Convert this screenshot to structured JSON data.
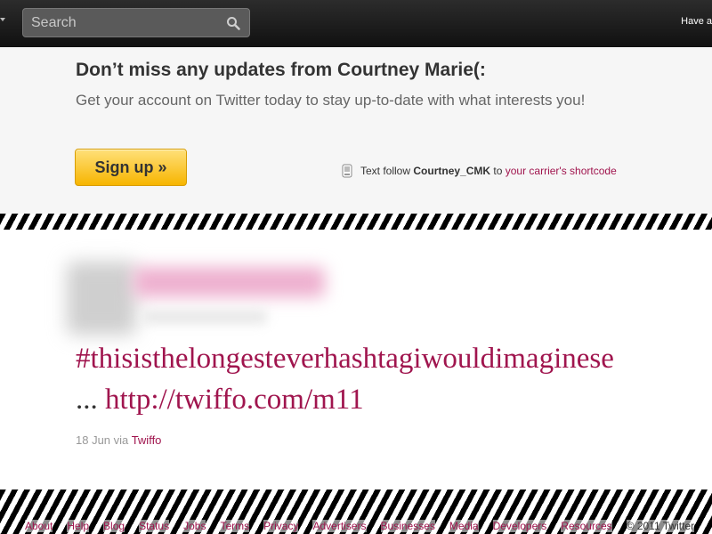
{
  "topbar": {
    "search_placeholder": "Search",
    "right_text": "Have a"
  },
  "banner": {
    "headline": "Don’t miss any updates from Courtney Marie(:",
    "subtext": "Get your account on Twitter today to stay up-to-date with what interests you!",
    "signup_label": "Sign up »",
    "text_follow_prefix": "Text follow",
    "text_follow_handle": "Courtney_CMK",
    "text_follow_to": "to",
    "text_follow_link": "your carrier's shortcode"
  },
  "tweet": {
    "hashtag": "#thisisthelongesteverhashtagiwouldimaginese",
    "ellipsis": "...",
    "url": "http://twiffo.com/m11",
    "date": "18 Jun",
    "via": "via",
    "source": "Twiffo"
  },
  "footer": {
    "links": [
      "About",
      "Help",
      "Blog",
      "Status",
      "Jobs",
      "Terms",
      "Privacy",
      "Advertisers",
      "Businesses",
      "Media",
      "Developers",
      "Resources"
    ],
    "copyright": "© 2011 Twitter"
  },
  "colors": {
    "link": "#a0154e",
    "signup": "#f7b500",
    "topbar": "#1a1a1a"
  },
  "icons": {
    "search": "search-icon",
    "phone": "phone-icon"
  }
}
